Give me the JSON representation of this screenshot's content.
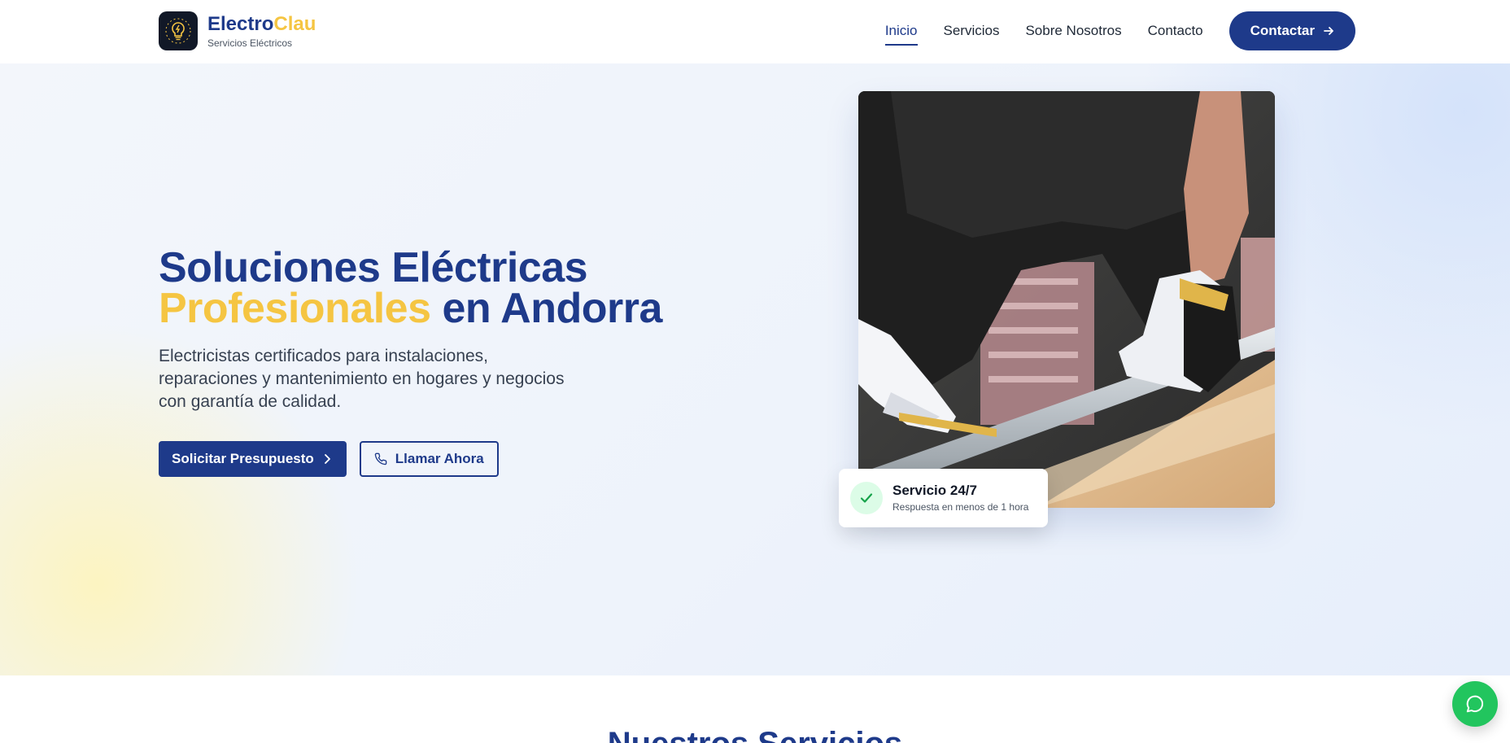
{
  "brand": {
    "name_part1": "Electro",
    "name_part2": "Clau",
    "tagline": "Servicios Eléctricos",
    "accent_color": "#f5c542",
    "primary_color": "#1e3a8a"
  },
  "nav": {
    "items": [
      {
        "label": "Inicio",
        "active": true
      },
      {
        "label": "Servicios",
        "active": false
      },
      {
        "label": "Sobre Nosotros",
        "active": false
      },
      {
        "label": "Contacto",
        "active": false
      }
    ],
    "cta_label": "Contactar",
    "cta_icon": "arrow-right-icon"
  },
  "hero": {
    "title_line1": "Soluciones Eléctricas",
    "title_highlight": "Profesionales",
    "title_rest": " en Andorra",
    "description": "Electricistas certificados para instalaciones, reparaciones y mantenimiento en hogares y negocios con garantía de calidad.",
    "primary_button": "Solicitar Presupuesto",
    "primary_button_icon": "chevron-right-icon",
    "secondary_button": "Llamar Ahora",
    "secondary_button_icon": "phone-icon"
  },
  "badge": {
    "title": "Servicio 24/7",
    "subtitle": "Respuesta en menos de 1 hora",
    "icon": "check-icon",
    "icon_color": "#16a34a"
  },
  "services_section": {
    "title": "Nuestros Servicios"
  },
  "whatsapp": {
    "icon": "whatsapp-icon",
    "color": "#22c55e"
  }
}
